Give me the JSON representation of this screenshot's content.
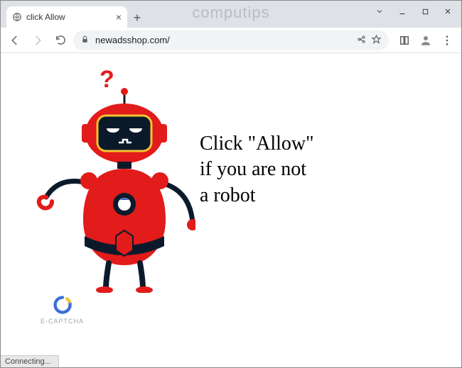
{
  "window": {
    "watermark": "computips"
  },
  "tab": {
    "title": "click Allow"
  },
  "addressbar": {
    "url": "newadsshop.com/"
  },
  "page": {
    "message_line1": "Click \"Allow\"",
    "message_line2": "if you are not",
    "message_line3": "a robot",
    "ecaptcha_label": "E-CAPTCHA"
  },
  "status": {
    "text": "Connecting..."
  },
  "colors": {
    "robot_red": "#e21b1b",
    "robot_dark": "#0b1a2b",
    "robot_accent": "#f4c430"
  }
}
